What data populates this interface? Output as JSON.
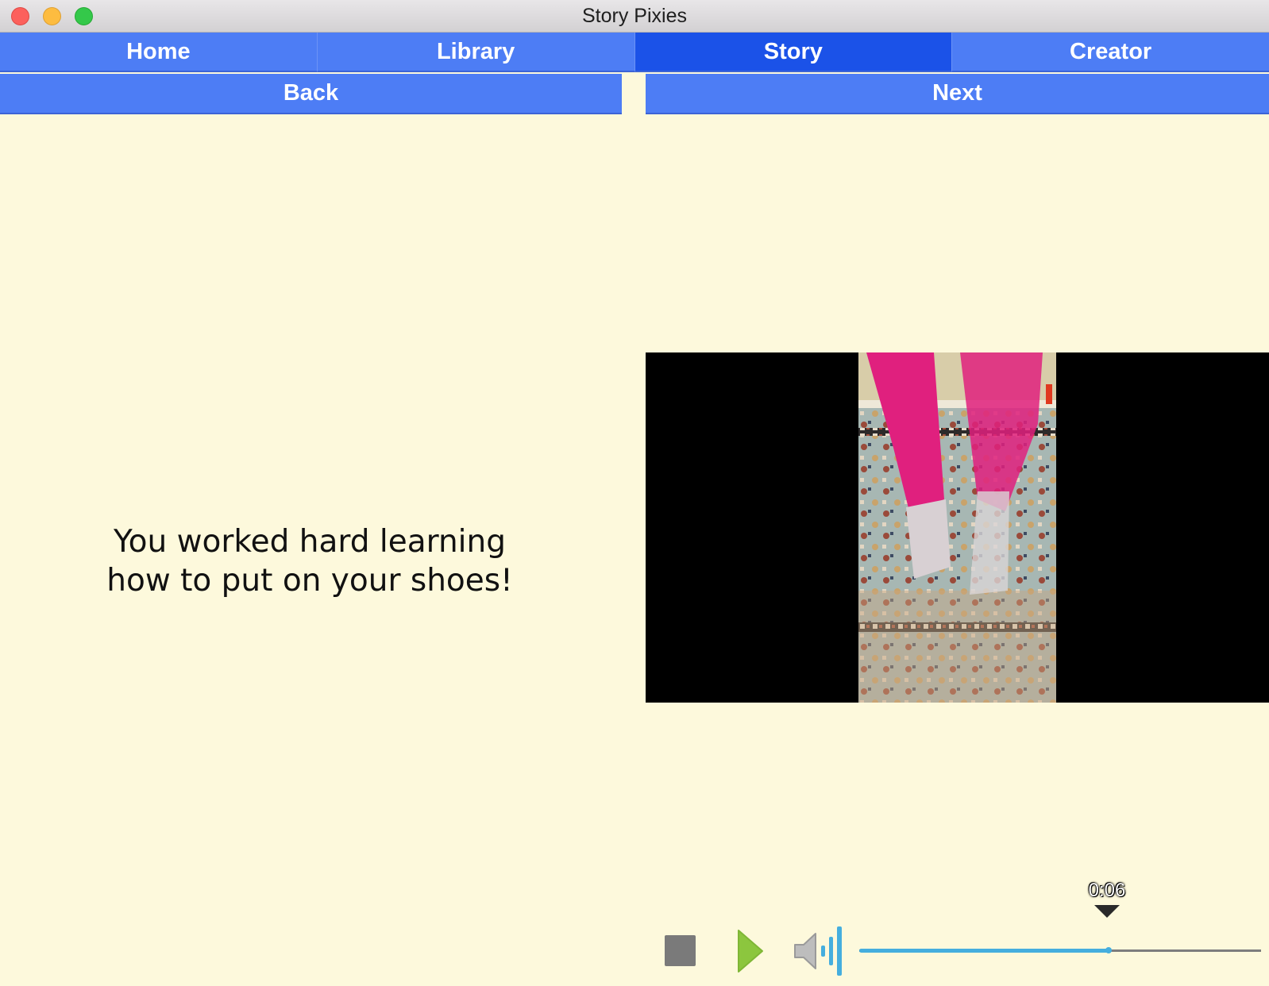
{
  "window": {
    "title": "Story Pixies"
  },
  "tabs": [
    {
      "label": "Home",
      "active": false
    },
    {
      "label": "Library",
      "active": false
    },
    {
      "label": "Story",
      "active": true
    },
    {
      "label": "Creator",
      "active": false
    }
  ],
  "nav": {
    "back_label": "Back",
    "next_label": "Next"
  },
  "story": {
    "line1": "You worked hard learning",
    "line2": "how to put on your shoes!"
  },
  "player": {
    "time_label": "0:06",
    "progress_fraction": 0.62,
    "accent_color": "#45aede",
    "play_color": "#8cc63e",
    "icons": [
      "stop-icon",
      "play-icon",
      "volume-icon"
    ]
  }
}
